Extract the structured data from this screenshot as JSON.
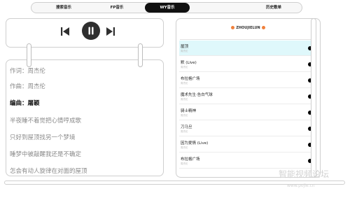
{
  "tabs": [
    "搜索音乐",
    "FP音乐",
    "WY音乐",
    "历史歌单"
  ],
  "active_tab": "WY音乐",
  "player": {
    "prev_icon": "skip-previous-icon",
    "play_pause_icon": "pause-icon",
    "next_icon": "skip-next-icon"
  },
  "lyrics": [
    "作词：周杰伦",
    "作曲：周杰伦",
    "编曲：屠颖",
    "半夜睡不着觉把心情哼成歌",
    "只好到屋顶找另一个梦境",
    "睡梦中被敲醒我还是不确定",
    "怎会有动人旋律在对面的屋顶"
  ],
  "playlist": {
    "header": "ZHOUJIELUN",
    "header_icon": "basketball-icon",
    "items": [
      {
        "title": "屋顶",
        "subtitle": "周杰伦"
      },
      {
        "title": "默 (Live)",
        "subtitle": "周杰伦"
      },
      {
        "title": "布拉格广场",
        "subtitle": "周杰伦"
      },
      {
        "title": "魔术先生·告白气球",
        "subtitle": "周杰伦"
      },
      {
        "title": "骑士精神",
        "subtitle": "周杰伦"
      },
      {
        "title": "刀马旦",
        "subtitle": "周杰伦"
      },
      {
        "title": "因为爱情 (Live)",
        "subtitle": "周杰伦"
      },
      {
        "title": "布拉格广场",
        "subtitle": "周杰伦"
      }
    ],
    "selected_index": 0
  },
  "watermark": {
    "text": "智能视频论坛",
    "url": "www.pojie.cn"
  }
}
